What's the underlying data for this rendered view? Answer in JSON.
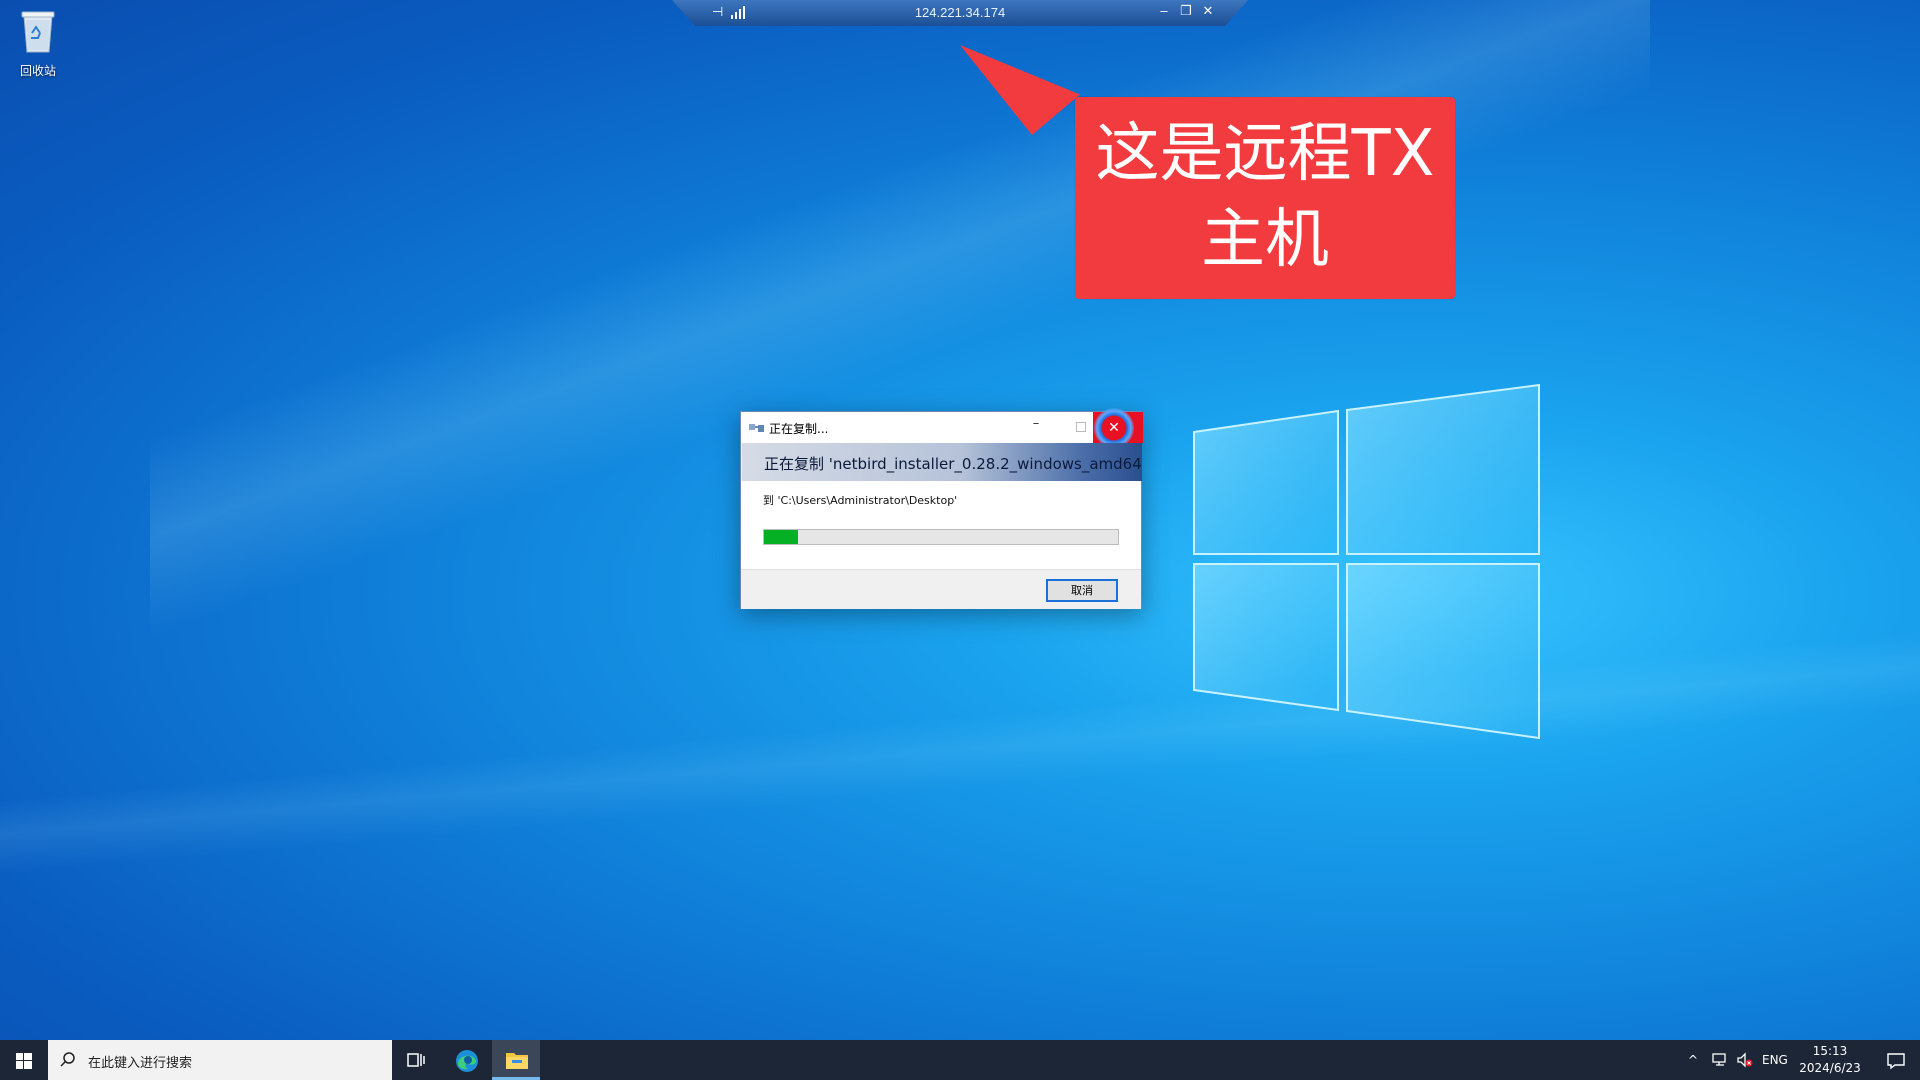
{
  "desktop": {
    "recycle_bin_label": "回收站"
  },
  "rdp_bar": {
    "host": "124.221.34.174",
    "pin_icon": "pin-icon",
    "signal_icon": "signal-bars-icon",
    "minimize": "–",
    "restore": "❐",
    "close": "✕"
  },
  "callout": {
    "line1": "这是远程TX",
    "line2": "主机",
    "color": "#f23b3f"
  },
  "dialog": {
    "title": "正在复制...",
    "heading": "正在复制 'netbird_installer_0.28.2_windows_amd64",
    "destination": "到 'C:\\Users\\Administrator\\Desktop'",
    "progress_fraction": 0.095,
    "cancel_label": "取消",
    "minimize": "–",
    "close": "✕",
    "progress_color": "#06b025"
  },
  "taskbar": {
    "search_placeholder": "在此键入进行搜索",
    "language": "ENG",
    "time": "15:13",
    "date": "2024/6/23",
    "tray_chevron": "^"
  }
}
